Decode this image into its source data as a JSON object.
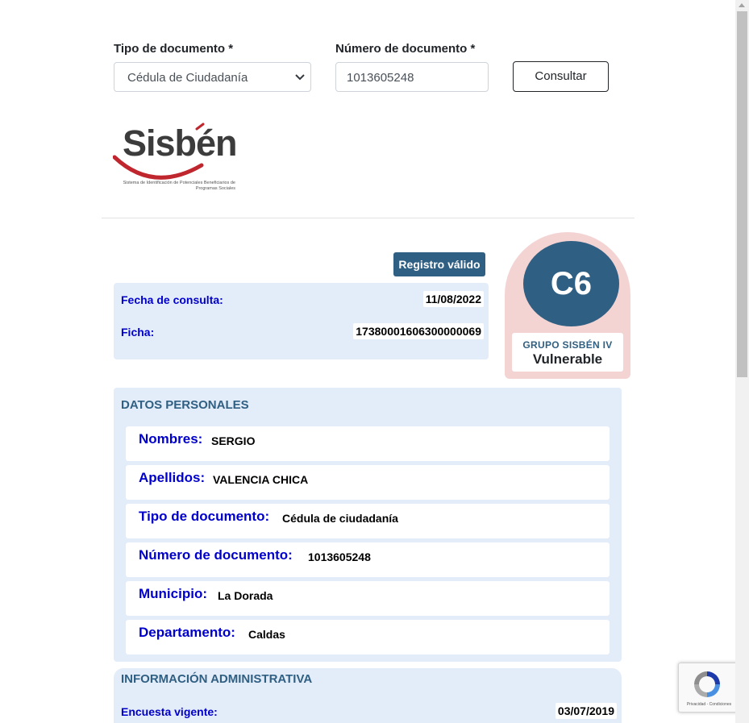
{
  "form": {
    "tipo_label": "Tipo de documento *",
    "tipo_selected": "Cédula de Ciudadanía",
    "numero_label": "Número de documento *",
    "numero_value": "1013605248",
    "consultar_label": "Consultar"
  },
  "logo": {
    "word": "Sisbén",
    "subtitle": "Sistema de Identificación de Potenciales Beneficiarios de Programas Sociales"
  },
  "status": {
    "badge": "Registro válido",
    "fecha_label": "Fecha de consulta:",
    "fecha_value": "11/08/2022",
    "ficha_label": "Ficha:",
    "ficha_value": "17380001606300000069"
  },
  "grupo": {
    "code": "C6",
    "group_name": "GRUPO SISBÉN IV",
    "category": "Vulnerable"
  },
  "personal": {
    "title": "DATOS PERSONALES",
    "rows": [
      {
        "label": "Nombres:",
        "value": "SERGIO"
      },
      {
        "label": "Apellidos:",
        "value": "VALENCIA CHICA"
      },
      {
        "label": "Tipo de documento:",
        "value": "Cédula de ciudadanía"
      },
      {
        "label": "Número de documento:",
        "value": "1013605248"
      },
      {
        "label": "Municipio:",
        "value": "La Dorada"
      },
      {
        "label": "Departamento:",
        "value": "Caldas"
      }
    ]
  },
  "admin": {
    "title": "INFORMACIÓN ADMINISTRATIVA",
    "encuesta_label": "Encuesta vigente:",
    "encuesta_value": "03/07/2019"
  },
  "recaptcha": {
    "text": "Privacidad - Condiciones"
  },
  "colors": {
    "brand_blue": "#2f5f82",
    "label_blue": "#0000cc",
    "panel_bg": "#e3ecf9",
    "badge_pink": "#f4d3d3",
    "logo_red": "#c0262d"
  }
}
